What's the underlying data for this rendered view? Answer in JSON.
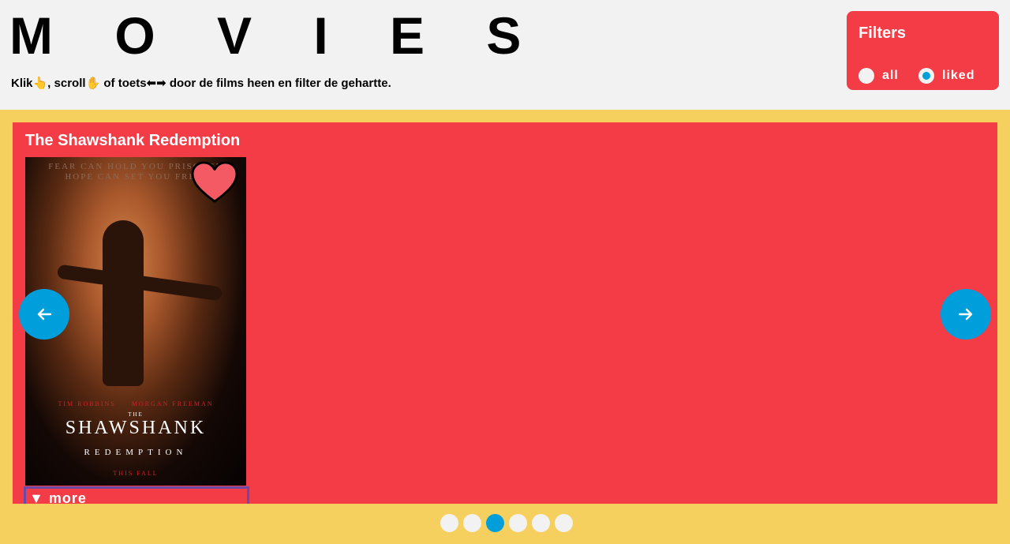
{
  "header": {
    "title": "M O V I E S",
    "instructions": "Klik👆, scroll✋ of toets⬅➡ door de films heen en filter de gehartte."
  },
  "filters": {
    "heading": "Filters",
    "options": [
      {
        "label": "all",
        "selected": false
      },
      {
        "label": "liked",
        "selected": true
      }
    ]
  },
  "movie": {
    "title": "The Shawshank Redemption",
    "liked": true,
    "more_label": "▼ more",
    "poster": {
      "tagline": "FEAR CAN HOLD YOU PRISONER\nHOPE CAN SET YOU FREE.",
      "actors": "TIM ROBBINS     MORGAN FREEMAN",
      "the": "THE",
      "title": "SHAWSHANK",
      "subtitle": "REDEMPTION",
      "release": "THIS FALL"
    }
  },
  "pagination": {
    "count": 6,
    "active_index": 2
  },
  "colors": {
    "accent_red": "#f43c47",
    "accent_blue": "#009fdb",
    "stage_yellow": "#f6d05e",
    "background": "#f2f2f2"
  },
  "icons": {
    "prev": "arrow-left-icon",
    "next": "arrow-right-icon",
    "like": "heart-icon"
  }
}
